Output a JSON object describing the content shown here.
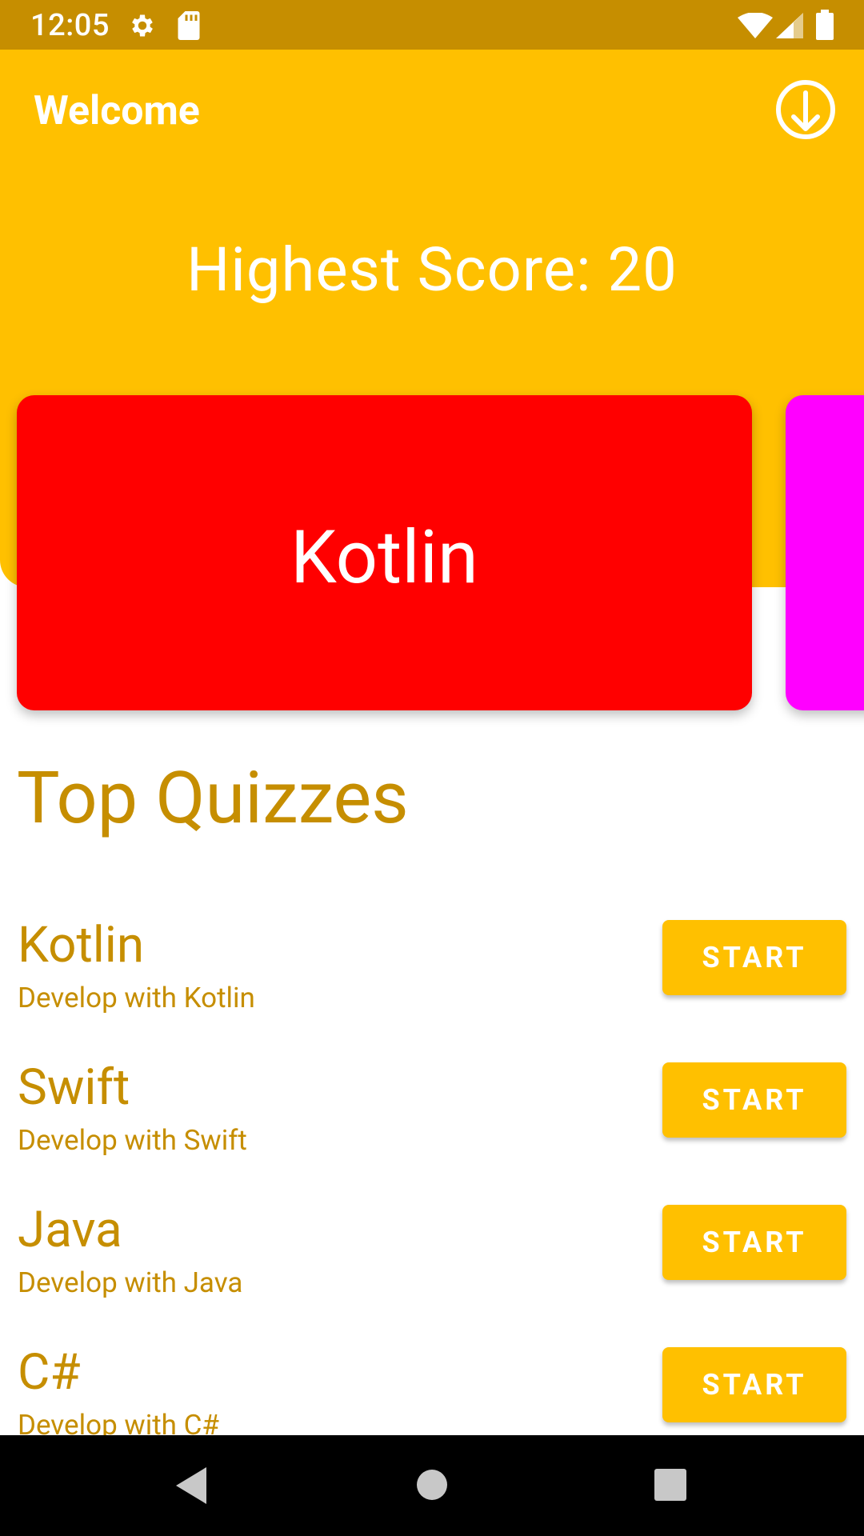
{
  "status_bar": {
    "time": "12:05",
    "icons": [
      "gear-icon",
      "sd-card-icon",
      "wifi-icon",
      "signal-icon",
      "battery-icon"
    ]
  },
  "header": {
    "title": "Welcome",
    "download_icon": "download-icon",
    "highest_score": "Highest Score: 20"
  },
  "carousel": {
    "cards": [
      {
        "label": "Kotlin",
        "color": "#FF0000"
      },
      {
        "label": "",
        "color": "#FF00FF"
      }
    ]
  },
  "section": {
    "title": "Top Quizzes"
  },
  "quizzes": [
    {
      "name": "Kotlin",
      "desc": "Develop with Kotlin",
      "button": "START"
    },
    {
      "name": "Swift",
      "desc": "Develop with Swift",
      "button": "START"
    },
    {
      "name": "Java",
      "desc": "Develop with Java",
      "button": "START"
    },
    {
      "name": "C#",
      "desc": "Develop with C#",
      "button": "START"
    }
  ],
  "nav_bar": {
    "icons": [
      "back-icon",
      "home-icon",
      "recents-icon"
    ]
  },
  "colors": {
    "primary": "#FFC000",
    "primary_dark": "#C68E00",
    "text_accent": "#C68E00"
  }
}
